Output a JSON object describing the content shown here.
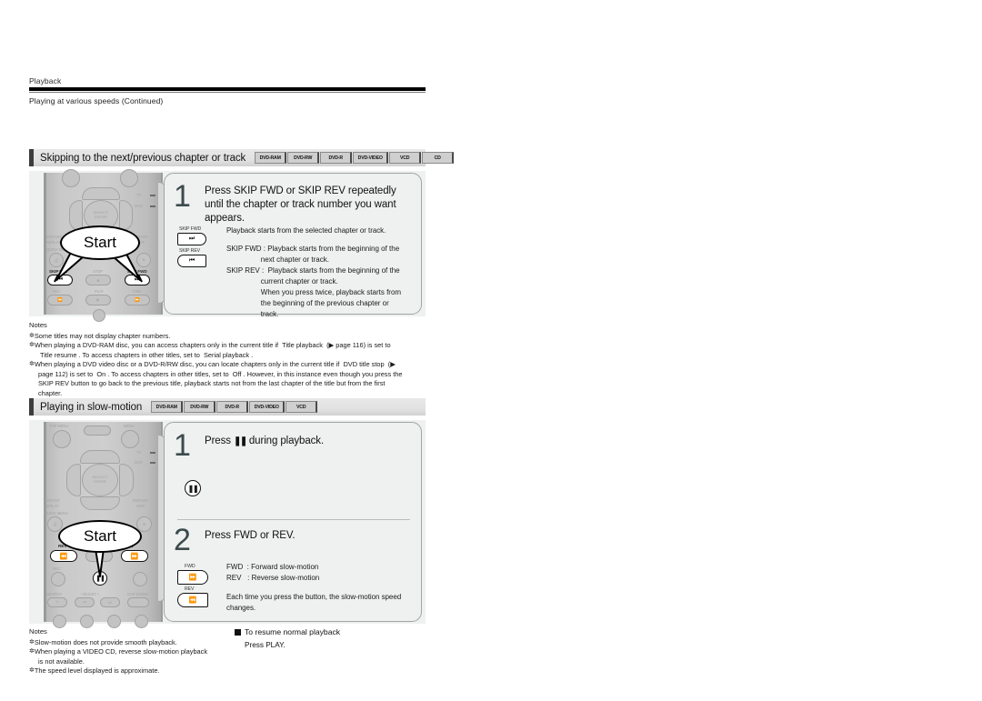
{
  "running_head": {
    "label": "Playback",
    "subtitle": "Playing at various speeds (Continued)"
  },
  "sections": [
    {
      "id": "skipping",
      "title": "Skipping to the next/previous chapter or track",
      "badges": [
        "DVD-RAM",
        "DVD-RW",
        "DVD-R",
        "DVD-VIDEO",
        "VCD",
        "CD"
      ],
      "remote": {
        "callout": "Start",
        "labels": {
          "tv": "TV",
          "dvd": "DVD",
          "select_enter_1": "SELECT/",
          "select_enter_2": "ENTER",
          "instant_replay_1": "INSTANT",
          "instant_replay_2": "REPLAY",
          "quick_menu": "QUICK MENU",
          "instant_skip_1": "INSTANT",
          "instant_skip_2": "SKIP",
          "skip_rev": "SKIP REV",
          "stop": "STOP",
          "skip_fwd": "SKIP FWD",
          "rev": "REV",
          "play": "PLAY",
          "fwd": "FWD"
        }
      },
      "steps": [
        {
          "number": "1",
          "title": "Press SKIP FWD or SKIP REV repeatedly until the chapter or track number you want appears.",
          "keys": [
            {
              "name": "skip-fwd-key",
              "label": "SKIP FWD",
              "glyph": "skip-forward-icon"
            },
            {
              "name": "skip-rev-key",
              "label": "SKIP REV",
              "glyph": "skip-backward-icon"
            }
          ],
          "lead_text": "Playback starts from the selected chapter or track.",
          "detail_lines": [
            "SKIP FWD : Playback starts from the beginning of the",
            "                 next chapter or track.",
            "SKIP REV :  Playback starts from the beginning of the",
            "                 current chapter or track.",
            "                 When you press twice, playback starts from",
            "                 the beginning of the previous chapter or",
            "                 track."
          ]
        }
      ],
      "notes": {
        "title": "Notes",
        "items": [
          "Some titles may not display chapter numbers.",
          "When playing a DVD-RAM disc, you can access chapters only in the current title if  Title playback  (▶ page 116) is set to\n   Title resume . To access chapters in other titles, set to  Serial playback .",
          "When playing a DVD video disc or a DVD-R/RW disc, you can locate chapters only in the current title if  DVD title stop  (▶\n  page 112) is set to  On . To access chapters in other titles, set to  Off . However, in this instance even though you press the\n  SKIP REV button to go back to the previous title, playback starts not from the last chapter of the title but from the first\n  chapter."
        ]
      }
    },
    {
      "id": "slow-motion",
      "title": "Playing in slow-motion",
      "badges": [
        "DVD-RAM",
        "DVD-RW",
        "DVD-R",
        "DVD-VIDEO",
        "VCD"
      ],
      "remote": {
        "callout": "Start",
        "labels": {
          "top_menu": "TOP MENU",
          "navi": "NAVI",
          "menu": "MENU",
          "tv": "TV",
          "dvd": "DVD",
          "select_enter_1": "SELECT/",
          "select_enter_2": "ENTER",
          "instant_replay_1": "INSTANT",
          "instant_replay_2": "REPLAY",
          "quick_menu": "QUICK MENU",
          "instant_skip_1": "INSTANT",
          "instant_skip_2": "SKIP",
          "rev": "REV",
          "fwd": "FWD",
          "rec": "REC",
          "search": "SEARCH",
          "adjust": "- ADJUST +",
          "chp_divide": "CHP DIVIDE"
        }
      },
      "steps": [
        {
          "number": "1",
          "title_prefix": "Press",
          "title_glyph": "pause-icon",
          "title_suffix": "during playback.",
          "keys": [
            {
              "name": "pause-key",
              "label": "",
              "glyph": "pause-icon"
            }
          ]
        },
        {
          "number": "2",
          "title": "Press FWD or REV.",
          "keys": [
            {
              "name": "fwd-key",
              "label": "FWD",
              "glyph": "fast-forward-icon"
            },
            {
              "name": "rev-key",
              "label": "REV",
              "glyph": "rewind-icon"
            }
          ],
          "detail_lines": [
            "FWD  : Forward slow-motion",
            "REV   : Reverse slow-motion"
          ],
          "note_text": "Each time you press the button, the slow-motion speed changes."
        }
      ],
      "notes": {
        "title": "Notes",
        "items": [
          "Slow-motion does not provide smooth playback.",
          "When playing a VIDEO CD, reverse slow-motion playback\n  is not available.",
          "The speed level displayed is approximate."
        ]
      },
      "resume": {
        "heading": "To resume normal playback",
        "text": "Press PLAY."
      }
    }
  ],
  "colors": {
    "panel_bg": "#eef1f0",
    "panel_border": "#9fa5a4",
    "step_number": "#3c4a4c",
    "header_bar": "#3d3d3d",
    "rule": "#000000"
  }
}
